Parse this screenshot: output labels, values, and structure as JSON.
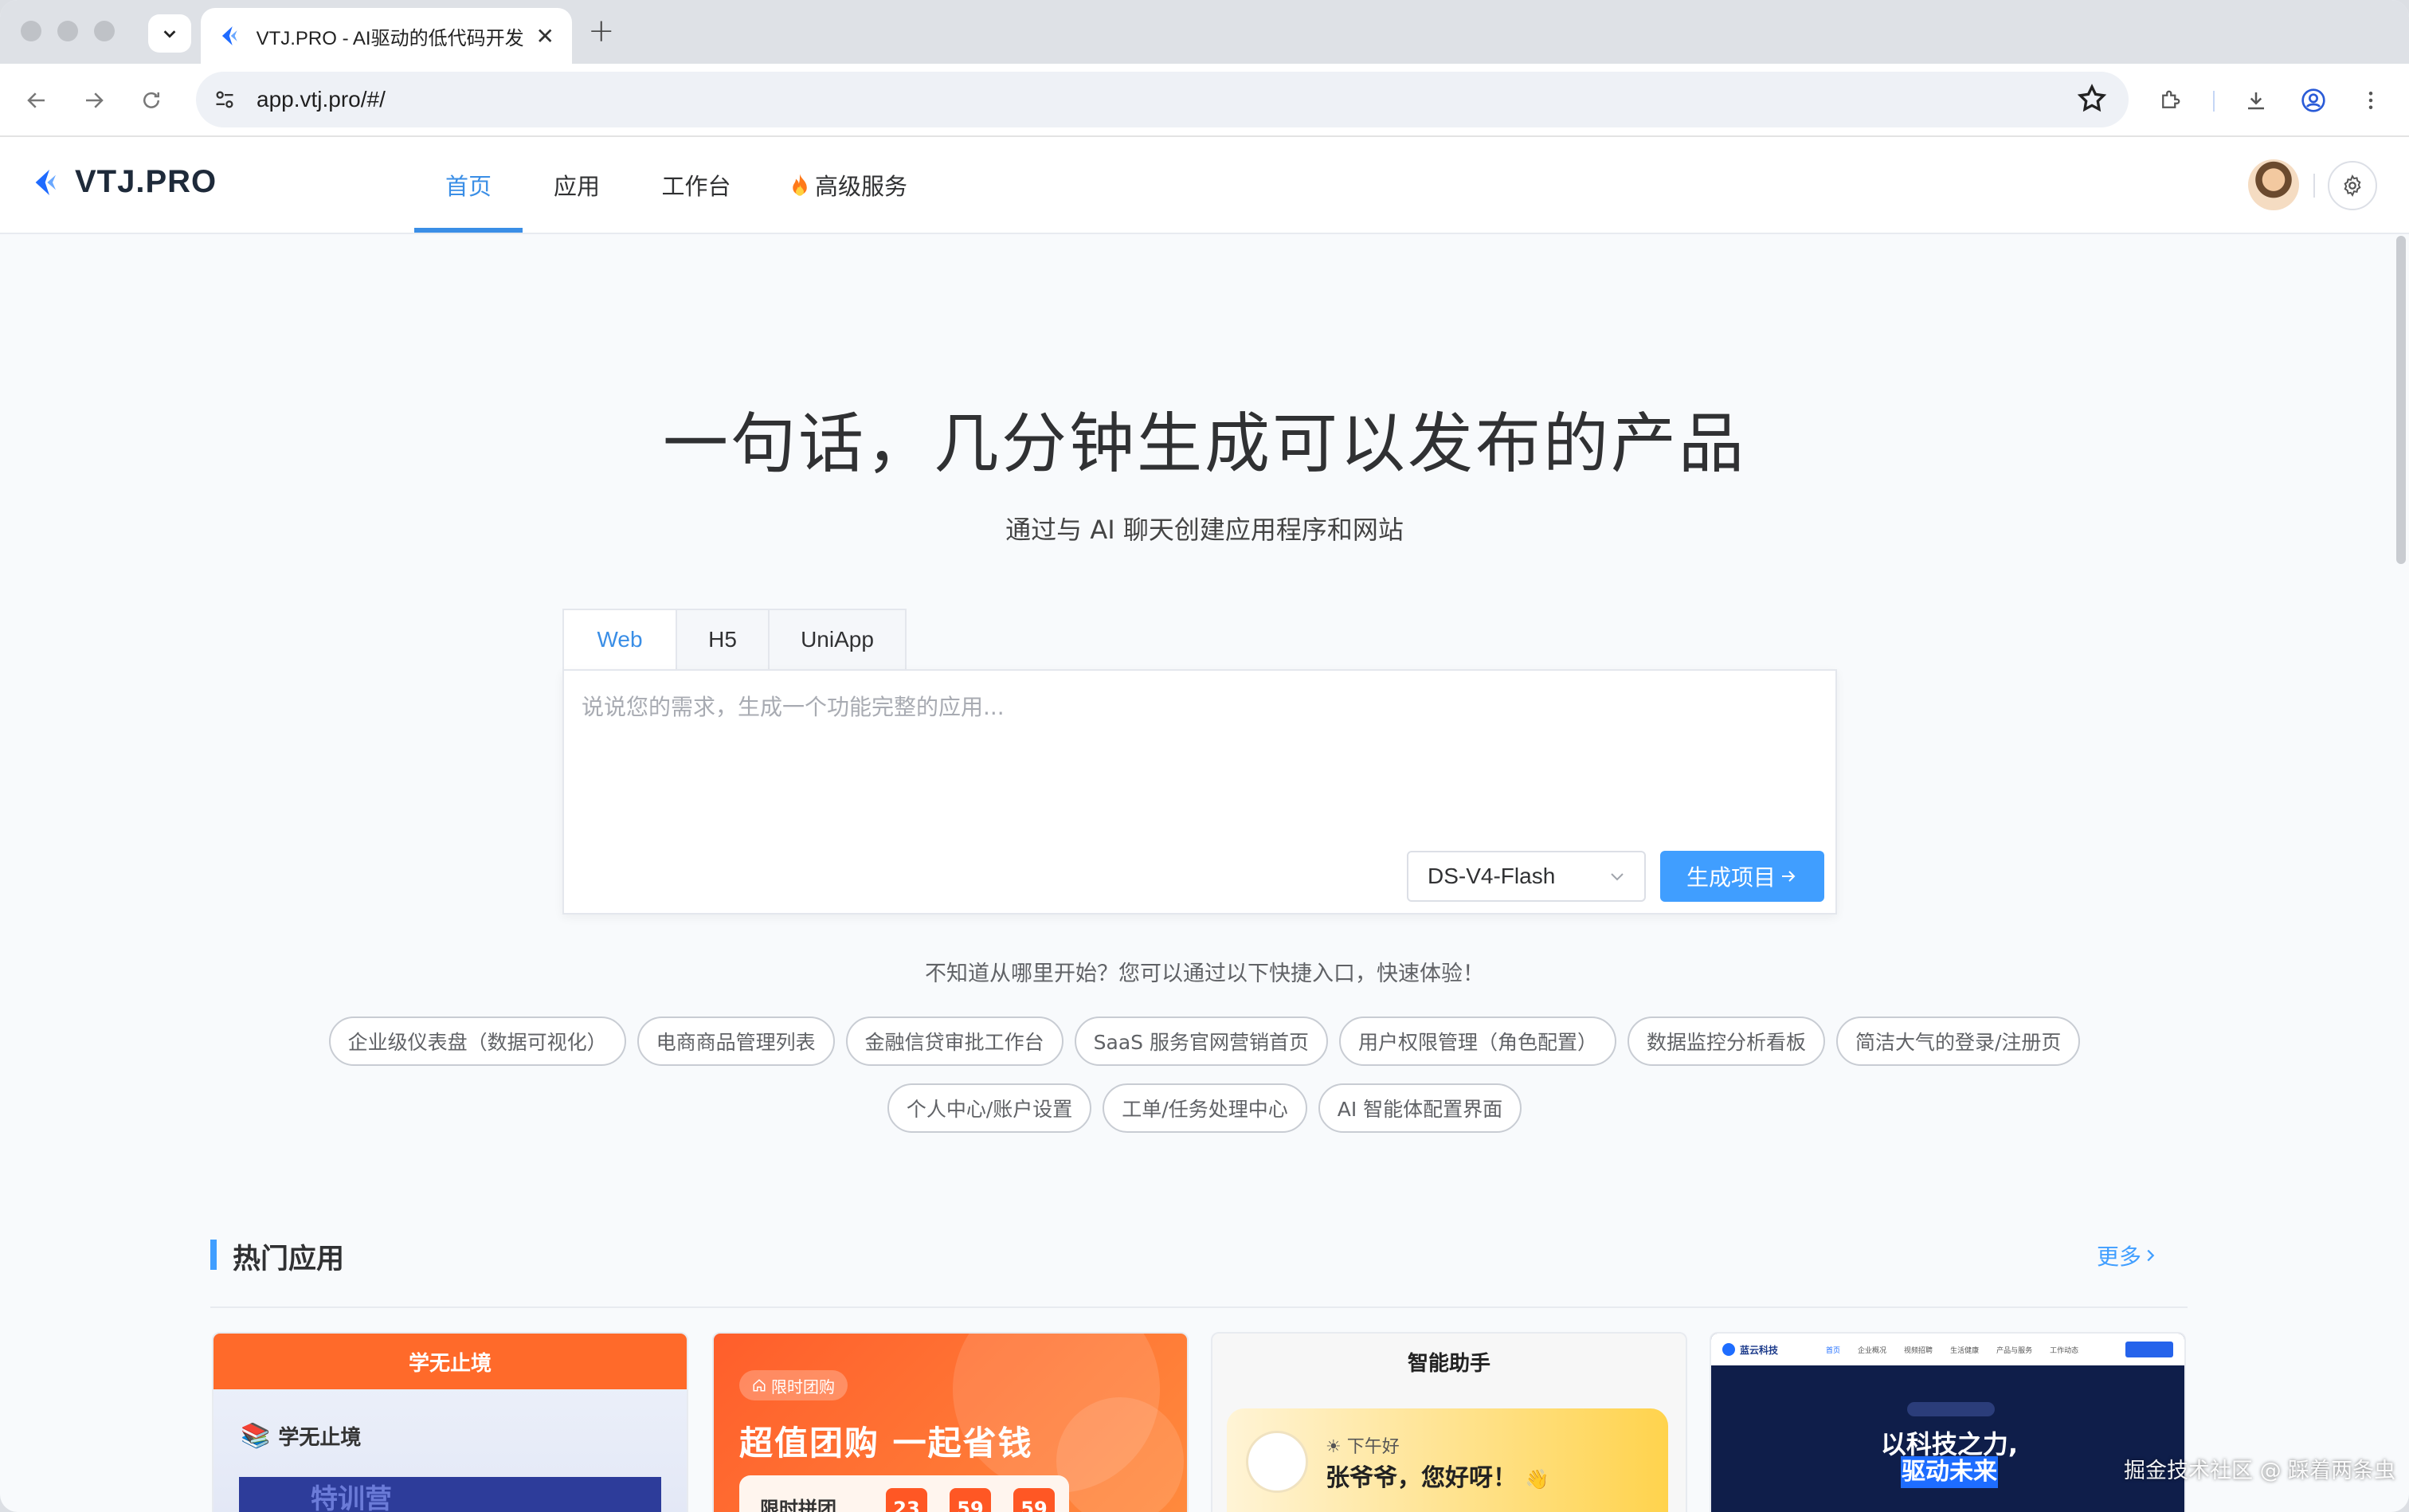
{
  "browser": {
    "tab_title": "VTJ.PRO - AI驱动的低代码开发",
    "url": "app.vtj.pro/#/"
  },
  "header": {
    "brand": "VTJ.PRO",
    "nav": [
      {
        "label": "首页",
        "active": true
      },
      {
        "label": "应用"
      },
      {
        "label": "工作台"
      },
      {
        "label": "高级服务",
        "icon": "fire-icon"
      }
    ]
  },
  "hero": {
    "title": "一句话，几分钟生成可以发布的产品",
    "subtitle": "通过与 AI 聊天创建应用程序和网站"
  },
  "composer": {
    "tabs": [
      "Web",
      "H5",
      "UniApp"
    ],
    "active_tab": "Web",
    "placeholder": "说说您的需求，生成一个功能完整的应用...",
    "model": "DS-V4-Flash",
    "submit_label": "生成项目"
  },
  "quick_start": {
    "hint": "不知道从哪里开始？您可以通过以下快捷入口，快速体验！",
    "chips": [
      "企业级仪表盘（数据可视化）",
      "电商商品管理列表",
      "金融信贷审批工作台",
      "SaaS 服务官网营销首页",
      "用户权限管理（角色配置）",
      "数据监控分析看板",
      "简洁大气的登录/注册页",
      "个人中心/账户设置",
      "工单/任务处理中心",
      "AI 智能体配置界面"
    ]
  },
  "popular": {
    "title": "热门应用",
    "more_label": "更多",
    "cards": [
      {
        "header": "学无止境",
        "sub": "学无止境",
        "banner": "特训营"
      },
      {
        "badge": "限时团购",
        "title": "超值团购 一起省钱",
        "panel": "限时拼团",
        "countdown": [
          "23",
          "59",
          "59"
        ]
      },
      {
        "header": "智能助手",
        "greeting": "下午好",
        "name": "张爷爷，您好呀！"
      },
      {
        "brand": "蓝云科技",
        "nav": [
          "首页",
          "企业概况",
          "视频招聘",
          "生活健康",
          "产品与服务",
          "工作动态"
        ],
        "title_line1": "以科技之力,",
        "title_line2": "驱动未来"
      }
    ]
  },
  "watermark": "掘金技术社区 @ 踩着两条虫",
  "colors": {
    "accent": "#409eff",
    "nav_active": "#3a8ee6",
    "orange": "#ff6a2a"
  }
}
